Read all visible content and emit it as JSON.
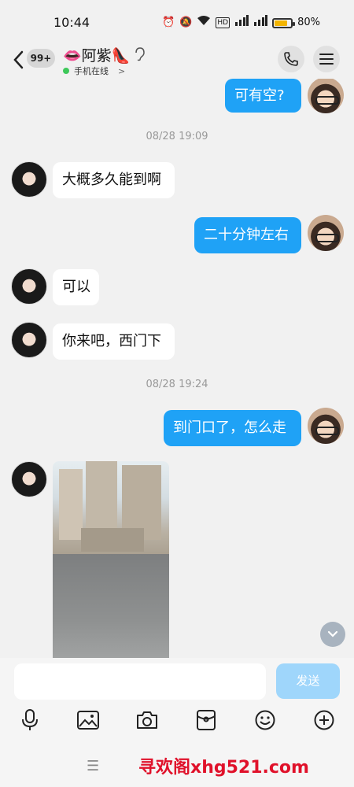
{
  "status_bar": {
    "time": "10:44",
    "battery": "80%"
  },
  "header": {
    "back_count": "99+",
    "contact_name": "👄阿紫👠",
    "online_status": "手机在线",
    "online_chevron": ">"
  },
  "messages": [
    {
      "sender": "me",
      "text": "可有空?"
    },
    {
      "type": "time",
      "text": "08/28 19:09"
    },
    {
      "sender": "her",
      "text": "大概多久能到啊"
    },
    {
      "sender": "me",
      "text": "二十分钟左右"
    },
    {
      "sender": "her",
      "text": "可以"
    },
    {
      "sender": "her",
      "text": "你来吧，西门下"
    },
    {
      "type": "time",
      "text": "08/28 19:24"
    },
    {
      "sender": "me",
      "text": "到门口了，怎么走"
    },
    {
      "sender": "her",
      "type": "image"
    }
  ],
  "input": {
    "placeholder": "",
    "send_label": "发送"
  },
  "toolbar": {
    "icons": [
      "microphone-icon",
      "image-icon",
      "camera-icon",
      "red-packet-icon",
      "emoji-icon",
      "plus-icon"
    ]
  },
  "footer": {
    "watermark": "寻欢阁xhg521.com"
  },
  "colors": {
    "sent_bubble": "#1fa2f6",
    "received_bubble": "#ffffff",
    "send_button": "#9fd6fb",
    "online_dot": "#3ec85a",
    "watermark": "#e0112a"
  }
}
